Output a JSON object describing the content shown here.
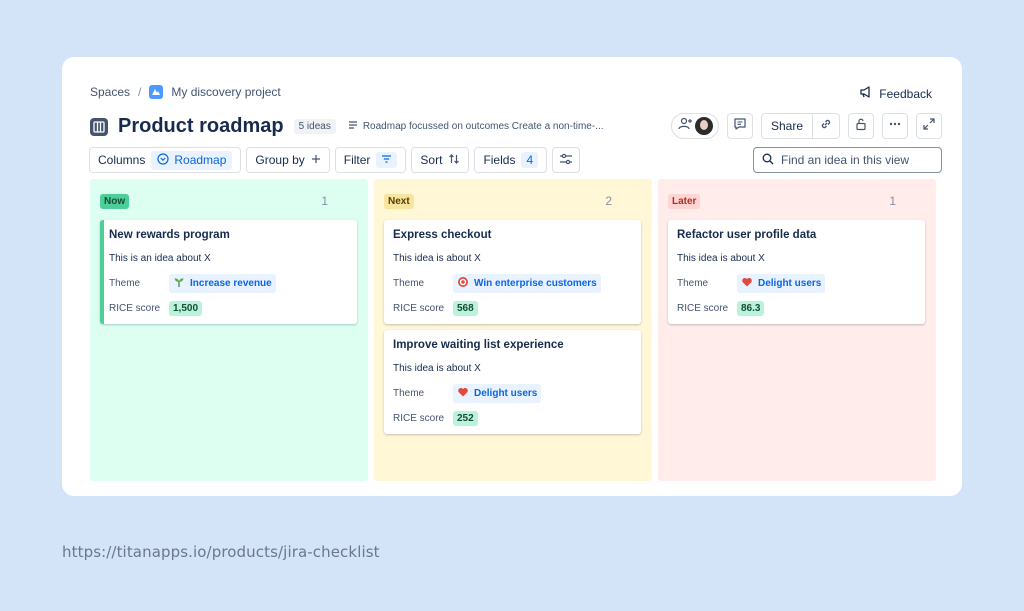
{
  "breadcrumb": {
    "spaces": "Spaces",
    "separator": "/",
    "project": "My discovery project"
  },
  "feedback_label": "Feedback",
  "header": {
    "title": "Product roadmap",
    "count": "5 ideas",
    "description": "Roadmap focussed on outcomes Create a non-time-..."
  },
  "actions": {
    "share_label": "Share"
  },
  "toolbar": {
    "columns_label": "Columns",
    "columns_value": "Roadmap",
    "group_by_label": "Group by",
    "filter_label": "Filter",
    "sort_label": "Sort",
    "fields_label": "Fields",
    "fields_count": "4",
    "search_placeholder": "Find an idea in this view"
  },
  "columns": [
    {
      "name": "Now",
      "count": "1",
      "cards": [
        {
          "title": "New rewards program",
          "desc": "This is an idea about X",
          "theme_label": "Theme",
          "theme": "Increase revenue",
          "theme_icon": "sprout-icon",
          "score_label": "RICE score",
          "score": "1,500"
        }
      ]
    },
    {
      "name": "Next",
      "count": "2",
      "cards": [
        {
          "title": "Express checkout",
          "desc": "This idea is about X",
          "theme_label": "Theme",
          "theme": "Win enterprise customers",
          "theme_icon": "target-icon",
          "score_label": "RICE score",
          "score": "568"
        },
        {
          "title": "Improve waiting list experience",
          "desc": "This idea is about X",
          "theme_label": "Theme",
          "theme": "Delight users",
          "theme_icon": "heart-icon",
          "score_label": "RICE score",
          "score": "252"
        }
      ]
    },
    {
      "name": "Later",
      "count": "1",
      "cards": [
        {
          "title": "Refactor user profile data",
          "desc": "This idea is about X",
          "theme_label": "Theme",
          "theme": "Delight users",
          "theme_icon": "heart-icon",
          "score_label": "RICE score",
          "score": "86.3"
        }
      ]
    }
  ],
  "footer_url": "https://titanapps.io/products/jira-checklist",
  "colors": {
    "page_bg": "#d3e3f8",
    "now": "#dcfff1",
    "next": "#fff7d6",
    "later": "#ffeceb",
    "link": "#0c66e4"
  }
}
